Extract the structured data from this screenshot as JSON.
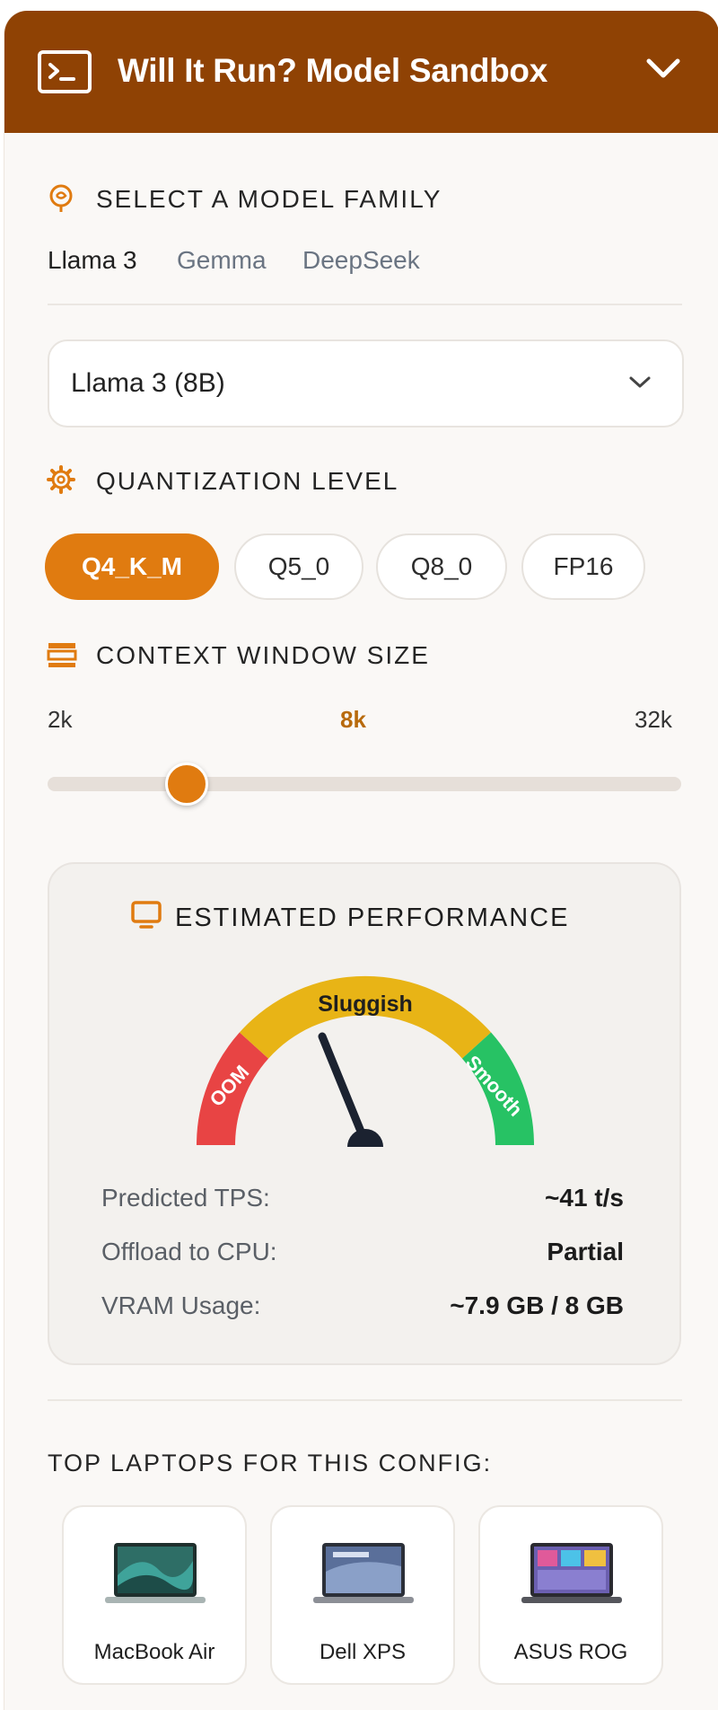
{
  "header": {
    "title": "Will It Run? Model Sandbox"
  },
  "model_family": {
    "label": "SELECT A MODEL FAMILY",
    "tabs": [
      "Llama 3",
      "Gemma",
      "DeepSeek"
    ],
    "active_tab": "Llama 3",
    "selected_model": "Llama 3 (8B)"
  },
  "quantization": {
    "label": "QUANTIZATION LEVEL",
    "options": [
      "Q4_K_M",
      "Q5_0",
      "Q8_0",
      "FP16"
    ],
    "selected": "Q4_K_M"
  },
  "context": {
    "label": "CONTEXT WINDOW SIZE",
    "min_label": "2k",
    "current_label": "8k",
    "max_label": "32k",
    "slider_position_fraction": 0.22
  },
  "performance": {
    "title": "ESTIMATED PERFORMANCE",
    "gauge": {
      "left_zone": "OOM",
      "middle_zone": "Sluggish",
      "right_zone": "Smooth"
    },
    "metrics": [
      {
        "label": "Predicted TPS:",
        "value": "~41 t/s"
      },
      {
        "label": "Offload to CPU:",
        "value": "Partial"
      },
      {
        "label": "VRAM Usage:",
        "value": "~7.9 GB / 8 GB"
      }
    ]
  },
  "laptops": {
    "title": "TOP LAPTOPS FOR THIS CONFIG:",
    "items": [
      "MacBook Air",
      "Dell XPS",
      "ASUS ROG"
    ]
  },
  "colors": {
    "header_bg": "#8f4204",
    "accent": "#e07b10",
    "gauge_red": "#e84444",
    "gauge_yellow": "#e8b416",
    "gauge_green": "#27c264",
    "needle": "#1b2230"
  },
  "icons": {
    "header": "terminal-icon",
    "collapse": "chevron-down-icon",
    "model": "brain-icon",
    "quantization": "gear-icon",
    "context": "layers-icon",
    "performance": "monitor-icon"
  }
}
